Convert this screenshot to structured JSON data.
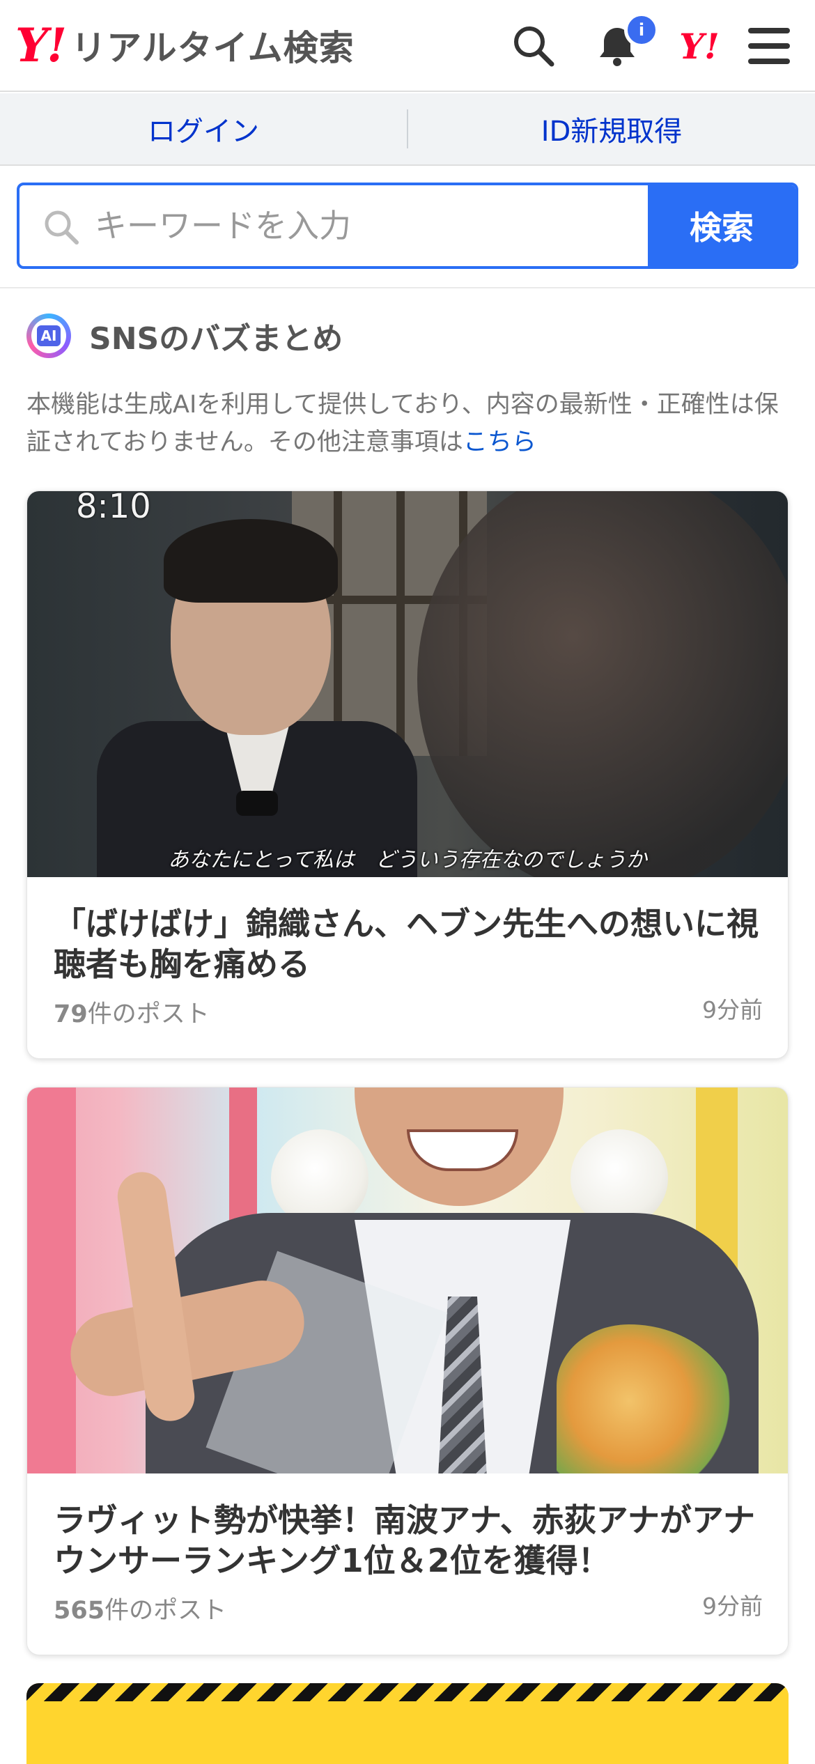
{
  "header": {
    "logo_mark": "Y!",
    "logo_text": "リアルタイム検索",
    "notification_count": "i",
    "yahoo_mark": "Y!"
  },
  "account": {
    "login_label": "ログイン",
    "signup_label": "ID新規取得"
  },
  "search": {
    "placeholder": "キーワードを入力",
    "button_label": "検索"
  },
  "section": {
    "ai_badge": "AI",
    "title": "SNSのバズまとめ",
    "notice_text": "本機能は生成AIを利用して提供しており、内容の最新性・正確性は保証されておりません。その他注意事項は",
    "notice_link": "こちら"
  },
  "cards": [
    {
      "overlay_time": "8:10",
      "subtitle": "あなたにとって私は　どういう存在なのでしょうか",
      "title": "「ばけばけ」錦織さん、ヘブン先生への想いに視聴者も胸を痛める",
      "post_count": "79",
      "post_suffix": "件のポスト",
      "time_ago": "9分前"
    },
    {
      "title": "ラヴィット勢が快挙！南波アナ、赤荻アナがアナウンサーランキング1位＆2位を獲得！",
      "post_count": "565",
      "post_suffix": "件のポスト",
      "time_ago": "9分前"
    }
  ],
  "colors": {
    "brand_red": "#ff0033",
    "accent_blue": "#2a6ef5",
    "link_blue": "#0033cc"
  }
}
